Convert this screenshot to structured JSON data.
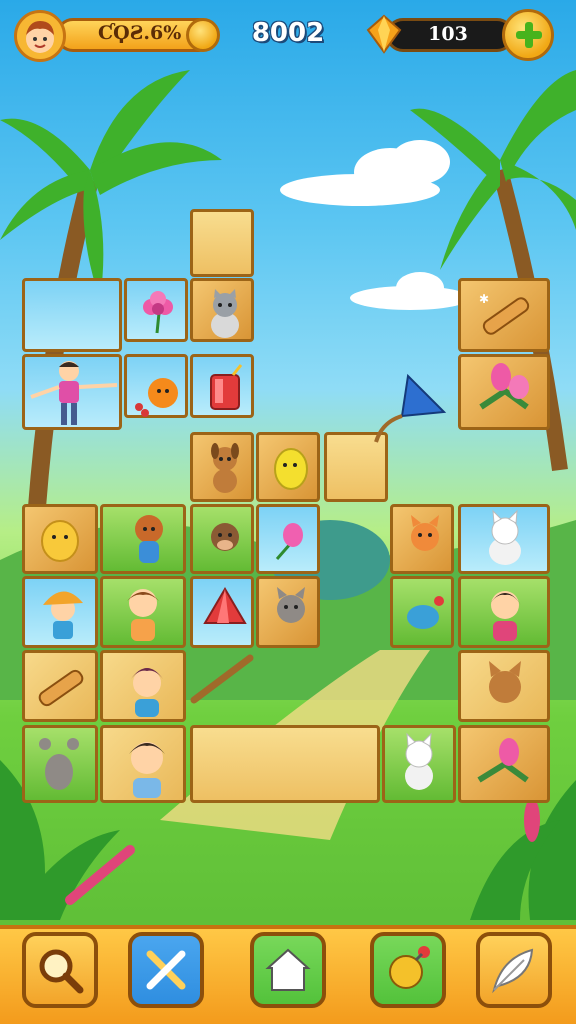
{
  "hud": {
    "level_bar_text": "ƇϘƧ.6%",
    "score": "8002",
    "gem_count": "103"
  },
  "toolbar": {
    "buttons": [
      {
        "name": "hint",
        "icon": "magnifier-icon",
        "color": "#f2a42a"
      },
      {
        "name": "shuffle",
        "icon": "crossed-tools-icon",
        "color": "#2f8ee0"
      },
      {
        "name": "house",
        "icon": "house-icon",
        "color": "#53c23b"
      },
      {
        "name": "bomb",
        "icon": "bomb-icon",
        "color": "#53c23b"
      },
      {
        "name": "feather",
        "icon": "feather-icon",
        "color": "#f2a42a"
      }
    ]
  },
  "colors": {
    "tile_border": "#9c6417",
    "tray": "#f39b1c",
    "sky": "#2aa9e8",
    "grass": "#6fcf3f"
  }
}
